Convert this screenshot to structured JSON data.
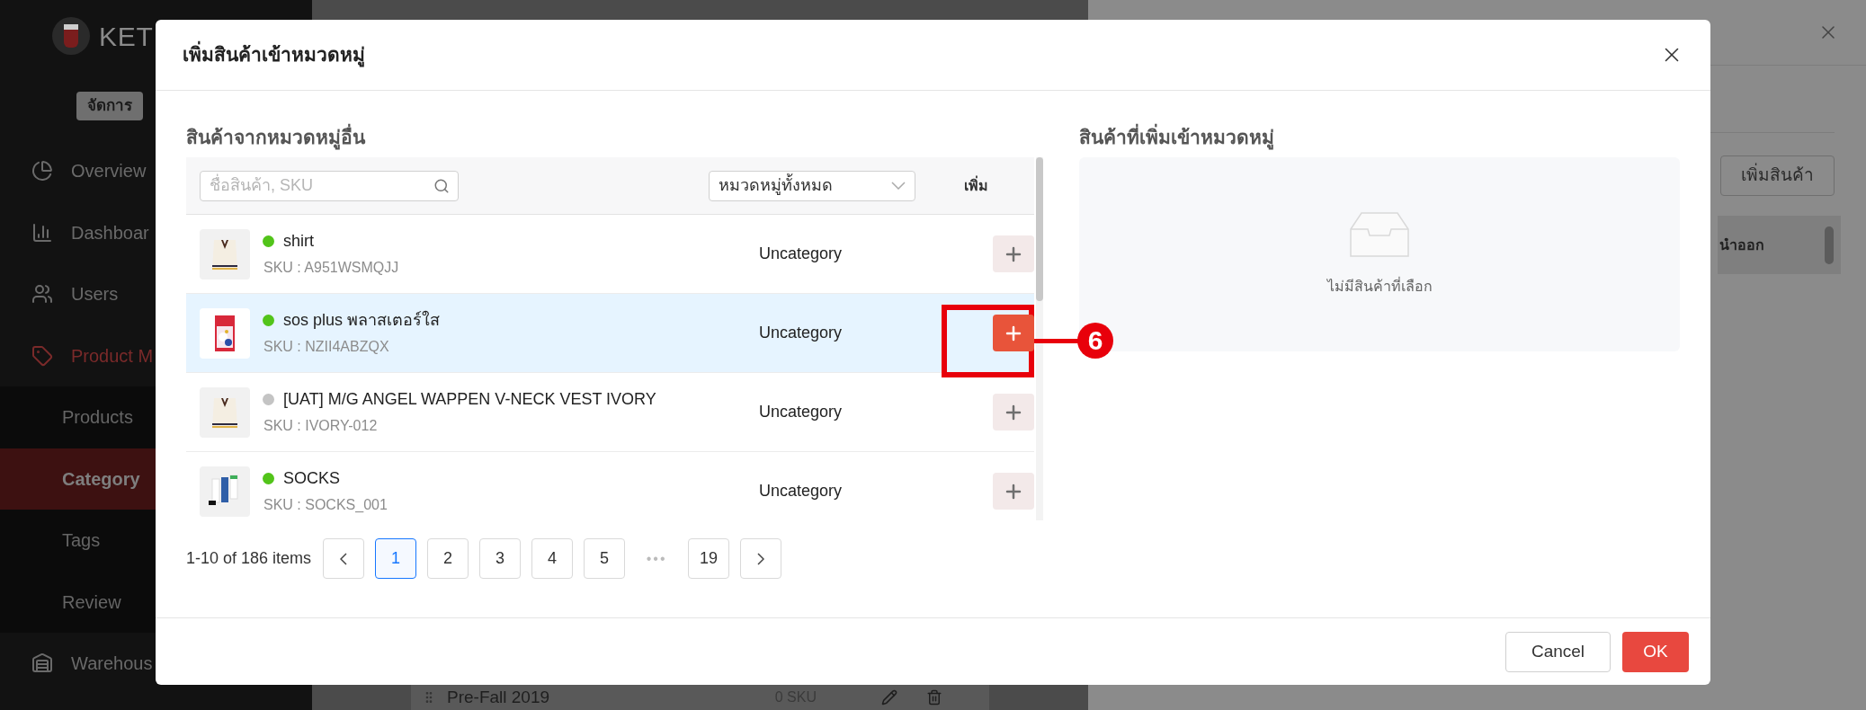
{
  "sidebar": {
    "logo_text": "KET",
    "manage_button": "จัดการ",
    "items": [
      {
        "label": "Overview",
        "kind": "top",
        "expanded": false,
        "selected": false
      },
      {
        "label": "Dashboar",
        "kind": "top",
        "expanded": false,
        "selected": false
      },
      {
        "label": "Users",
        "kind": "top",
        "expanded": false,
        "selected": false
      },
      {
        "label": "Product M",
        "kind": "top",
        "expanded": true,
        "selected": false
      },
      {
        "label": "Products",
        "kind": "sub",
        "selected": false
      },
      {
        "label": "Category",
        "kind": "sub",
        "selected": true
      },
      {
        "label": "Tags",
        "kind": "sub",
        "selected": false
      },
      {
        "label": "Review",
        "kind": "sub",
        "selected": false
      },
      {
        "label": "Warehous",
        "kind": "top",
        "expanded": false,
        "selected": false
      }
    ]
  },
  "background_list": {
    "name": "Pre-Fall 2019",
    "count": "0 SKU"
  },
  "drawer": {
    "add_button": "เพิ่มสินค้า",
    "table_header": "นำออก"
  },
  "modal": {
    "title": "เพิ่มสินค้าเข้าหมวดหมู่",
    "left": {
      "title": "สินค้าจากหมวดหมู่อื่น",
      "search": {
        "placeholder": "ชื่อสินค้า, SKU"
      },
      "category_select": "หมวดหมู่ทั้งหมด",
      "add_column": "เพิ่ม",
      "rows": [
        {
          "name": "shirt",
          "sku": "SKU : A951WSMQJJ",
          "category": "Uncategory",
          "color": "#52c41a",
          "selected": false
        },
        {
          "name": "sos plus พลาสเตอร์ใส",
          "sku": "SKU : NZII4ABZQX",
          "category": "Uncategory",
          "color": "#52c41a",
          "selected": true
        },
        {
          "name": "[UAT] M/G ANGEL WAPPEN V-NECK VEST IVORY",
          "sku": "SKU : IVORY-012",
          "category": "Uncategory",
          "color": "#c4c4c4",
          "selected": false
        },
        {
          "name": "SOCKS",
          "sku": "SKU : SOCKS_001",
          "category": "Uncategory",
          "color": "#52c41a",
          "selected": false
        }
      ],
      "pagination": {
        "summary": "1-10 of 186 items",
        "pages": [
          {
            "label": "1",
            "selected": true
          },
          {
            "label": "2",
            "selected": false
          },
          {
            "label": "3",
            "selected": false
          },
          {
            "label": "4",
            "selected": false
          },
          {
            "label": "5",
            "selected": false
          },
          {
            "label": "•••",
            "kind": "ellipsis"
          },
          {
            "label": "19",
            "selected": false
          }
        ]
      }
    },
    "right": {
      "title": "สินค้าที่เพิ่มเข้าหมวดหมู่",
      "empty_text": "ไม่มีสินค้าที่เลือก"
    },
    "buttons": [
      {
        "label": "Cancel",
        "kind": "default"
      },
      {
        "label": "OK",
        "kind": "primary"
      }
    ],
    "callout": {
      "number": "6"
    }
  }
}
